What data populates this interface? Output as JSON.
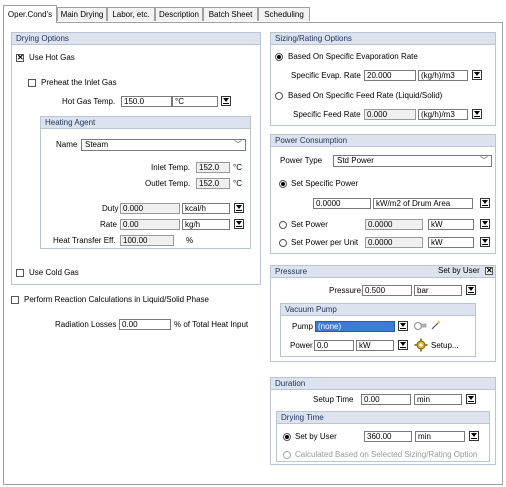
{
  "tabs": [
    "Oper.Cond's",
    "Main Drying",
    "Labor, etc.",
    "Description",
    "Batch Sheet",
    "Scheduling"
  ],
  "drying_options": {
    "title": "Drying Options",
    "use_hot_gas": "Use Hot Gas",
    "use_hot_gas_checked": true,
    "preheat_inlet": "Preheat the Inlet Gas",
    "hot_gas_temp_label": "Hot Gas Temp.",
    "hot_gas_temp_value": "150.0",
    "hot_gas_temp_unit": "°C",
    "heating_agent": {
      "title": "Heating Agent",
      "name_label": "Name",
      "name_value": "Steam",
      "inlet_temp_label": "Inlet Temp.",
      "inlet_temp_value": "152.0",
      "inlet_temp_unit": "°C",
      "outlet_temp_label": "Outlet Temp.",
      "outlet_temp_value": "152.0",
      "outlet_temp_unit": "°C",
      "duty_label": "Duty",
      "duty_value": "0.000",
      "duty_unit": "kcal/h",
      "rate_label": "Rate",
      "rate_value": "0.00",
      "rate_unit": "kg/h",
      "hte_label": "Heat Transfer Eff.",
      "hte_value": "100.00",
      "hte_unit": "%"
    },
    "use_cold_gas": "Use Cold Gas"
  },
  "reaction_calc": "Perform Reaction Calculations in Liquid/Solid Phase",
  "radiation_losses_label": "Radiation Losses",
  "radiation_losses_value": "0.00",
  "radiation_losses_unit": "% of Total Heat Input",
  "sizing": {
    "title": "Sizing/Rating Options",
    "opt1": "Based On Specific Evaporation Rate",
    "evap_label": "Specific Evap. Rate",
    "evap_value": "20.000",
    "evap_unit": "(kg/h)/m3",
    "opt2": "Based On Specific Feed Rate (Liquid/Solid)",
    "feed_label": "Specific Feed Rate",
    "feed_value": "0.000",
    "feed_unit": "(kg/h)/m3"
  },
  "power": {
    "title": "Power Consumption",
    "type_label": "Power Type",
    "type_value": "Std Power",
    "specific_label": "Set Specific Power",
    "specific_value": "0.0000",
    "specific_unit": "kW/m2 of Drum Area",
    "set_power_label": "Set Power",
    "set_power_value": "0.0000",
    "set_power_unit": "kW",
    "per_unit_label": "Set Power per Unit",
    "per_unit_value": "0.0000",
    "per_unit_unit": "kW"
  },
  "pressure": {
    "title": "Pressure",
    "set_by_user": "Set by User",
    "pressure_label": "Pressure",
    "pressure_value": "0.500",
    "pressure_unit": "bar",
    "vacuum": {
      "title": "Vacuum Pump",
      "pump_label": "Pump",
      "pump_value": "(none)",
      "power_label": "Power",
      "power_value": "0.0",
      "power_unit": "kW",
      "setup_label": "Setup..."
    }
  },
  "duration": {
    "title": "Duration",
    "setup_label": "Setup Time",
    "setup_value": "0.00",
    "setup_unit": "min",
    "drying_time": {
      "title": "Drying Time",
      "set_by_user": "Set by User",
      "value": "360.00",
      "unit": "min",
      "calc_label": "Calculated Based on Selected Sizing/Rating Option"
    }
  },
  "colors": {
    "group_header": "#dce3ee",
    "group_border": "#b9c4d4",
    "selection": "#3e7bd6"
  }
}
